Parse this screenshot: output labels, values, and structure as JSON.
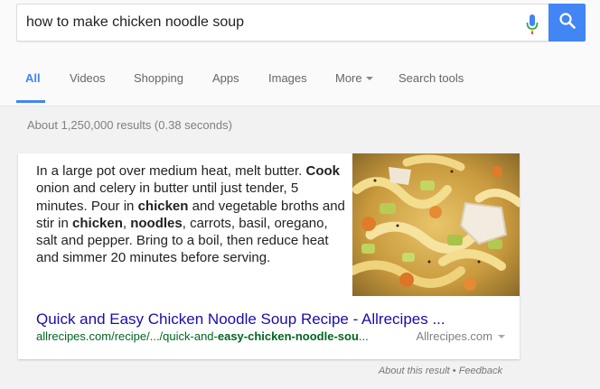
{
  "search": {
    "query": "how to make chicken noodle soup",
    "mic_icon": "microphone-icon",
    "search_icon": "magnifier-icon",
    "button_color": "#4285f4"
  },
  "tabs": [
    {
      "label": "All",
      "active": true
    },
    {
      "label": "Videos"
    },
    {
      "label": "Shopping"
    },
    {
      "label": "Apps"
    },
    {
      "label": "Images"
    },
    {
      "label": "More"
    },
    {
      "label": "Search tools"
    }
  ],
  "results_stats": "About 1,250,000 results (0.38 seconds)",
  "featured_snippet": {
    "text_parts": [
      "In a large pot over medium heat, melt butter. ",
      "Cook",
      " onion and celery in butter until just tender, 5 minutes. Pour in ",
      "chicken",
      " and vegetable broths and stir in ",
      "chicken",
      ", ",
      "noodles",
      ", carrots, basil, oregano, salt and pepper. Bring to a boil, then reduce heat and simmer 20 minutes before serving."
    ],
    "image": "chicken-noodle-soup-photo",
    "title": "Quick and Easy Chicken Noodle Soup Recipe - Allrecipes ...",
    "url_prefix": "allrecipes.com/recipe/.../quick-and-",
    "url_bold": "easy-chicken-noodle-sou",
    "url_suffix": "...",
    "source": "Allrecipes.com"
  },
  "footer": {
    "about": "About this result",
    "separator": " • ",
    "feedback": "Feedback"
  },
  "colors": {
    "link": "#1a0dab",
    "url": "#006621",
    "accent": "#4285f4"
  }
}
